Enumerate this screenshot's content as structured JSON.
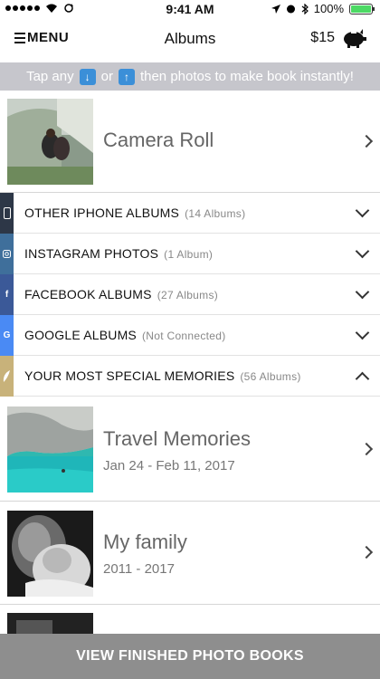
{
  "status_bar": {
    "time": "9:41 AM",
    "battery": "100%"
  },
  "nav": {
    "menu_label": "MENU",
    "title": "Albums",
    "price": "$15"
  },
  "banner": {
    "prefix": "Tap any",
    "middle": "or",
    "suffix": "then photos to make book instantly!"
  },
  "camera_roll": {
    "label": "Camera Roll"
  },
  "categories": [
    {
      "label": "OTHER IPHONE ALBUMS",
      "count": "(14 Albums)",
      "icon": "phone-icon",
      "color": "#2d3747",
      "state": "collapsed"
    },
    {
      "label": "INSTAGRAM PHOTOS",
      "count": "(1 Album)",
      "icon": "instagram-icon",
      "color": "#3f6f9b",
      "state": "collapsed"
    },
    {
      "label": "FACEBOOK ALBUMS",
      "count": "(27 Albums)",
      "icon": "facebook-icon",
      "color": "#3b5998",
      "state": "collapsed"
    },
    {
      "label": "GOOGLE ALBUMS",
      "count": "(Not Connected)",
      "icon": "google-icon",
      "color": "#4a8af4",
      "state": "collapsed"
    },
    {
      "label": "YOUR MOST SPECIAL MEMORIES",
      "count": "(56 Albums)",
      "icon": "feather-icon",
      "color": "#c8b27a",
      "state": "expanded"
    }
  ],
  "albums": [
    {
      "title": "Travel Memories",
      "dates": "Jan 24 - Feb 11, 2017"
    },
    {
      "title": "My family",
      "dates": "2011 - 2017"
    }
  ],
  "bottom_button": {
    "label": "VIEW FINISHED PHOTO BOOKS"
  }
}
